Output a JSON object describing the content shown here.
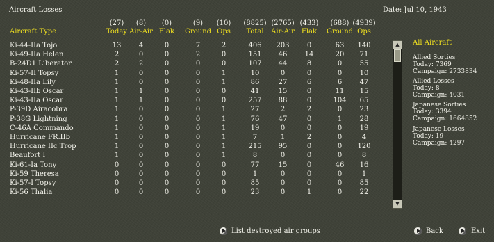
{
  "header": {
    "title": "Aircraft Losses",
    "date": "Date: Jul 10, 1943"
  },
  "columns": [
    {
      "count": "",
      "label": "Aircraft Type"
    },
    {
      "count": "(27)",
      "label": "Today"
    },
    {
      "count": "(8)",
      "label": "Air-Air"
    },
    {
      "count": "(0)",
      "label": "Flak"
    },
    {
      "count": "(9)",
      "label": "Ground"
    },
    {
      "count": "(10)",
      "label": "Ops"
    },
    {
      "count": "(8825)",
      "label": "Total"
    },
    {
      "count": "(2765)",
      "label": "Air-Air"
    },
    {
      "count": "(433)",
      "label": "Flak"
    },
    {
      "count": "(688)",
      "label": "Ground"
    },
    {
      "count": "(4939)",
      "label": "Ops"
    }
  ],
  "rows": [
    {
      "name": "Ki-44-IIa Tojo",
      "v": [
        "13",
        "4",
        "0",
        "7",
        "2",
        "406",
        "203",
        "0",
        "63",
        "140"
      ]
    },
    {
      "name": "Ki-49-IIa Helen",
      "v": [
        "2",
        "0",
        "0",
        "2",
        "0",
        "151",
        "46",
        "14",
        "20",
        "71"
      ]
    },
    {
      "name": "B-24D1 Liberator",
      "v": [
        "2",
        "2",
        "0",
        "0",
        "0",
        "107",
        "44",
        "8",
        "0",
        "55"
      ]
    },
    {
      "name": "Ki-57-II Topsy",
      "v": [
        "1",
        "0",
        "0",
        "0",
        "1",
        "10",
        "0",
        "0",
        "0",
        "10"
      ]
    },
    {
      "name": "Ki-48-IIa Lily",
      "v": [
        "1",
        "0",
        "0",
        "0",
        "1",
        "86",
        "27",
        "6",
        "6",
        "47"
      ]
    },
    {
      "name": "Ki-43-IIb Oscar",
      "v": [
        "1",
        "1",
        "0",
        "0",
        "0",
        "41",
        "15",
        "0",
        "11",
        "15"
      ]
    },
    {
      "name": "Ki-43-IIa Oscar",
      "v": [
        "1",
        "1",
        "0",
        "0",
        "0",
        "257",
        "88",
        "0",
        "104",
        "65"
      ]
    },
    {
      "name": "P-39D Airacobra",
      "v": [
        "1",
        "0",
        "0",
        "0",
        "1",
        "27",
        "2",
        "2",
        "0",
        "23"
      ]
    },
    {
      "name": "P-38G Lightning",
      "v": [
        "1",
        "0",
        "0",
        "0",
        "1",
        "76",
        "47",
        "0",
        "1",
        "28"
      ]
    },
    {
      "name": "C-46A Commando",
      "v": [
        "1",
        "0",
        "0",
        "0",
        "1",
        "19",
        "0",
        "0",
        "0",
        "19"
      ]
    },
    {
      "name": "Hurricane FR.IIb",
      "v": [
        "1",
        "0",
        "0",
        "0",
        "1",
        "7",
        "1",
        "2",
        "0",
        "4"
      ]
    },
    {
      "name": "Hurricane IIc Trop",
      "v": [
        "1",
        "0",
        "0",
        "0",
        "1",
        "215",
        "95",
        "0",
        "0",
        "120"
      ]
    },
    {
      "name": "Beaufort I",
      "v": [
        "1",
        "0",
        "0",
        "0",
        "1",
        "8",
        "0",
        "0",
        "0",
        "8"
      ]
    },
    {
      "name": "Ki-61-Ia Tony",
      "v": [
        "0",
        "0",
        "0",
        "0",
        "0",
        "77",
        "15",
        "0",
        "46",
        "16"
      ]
    },
    {
      "name": "Ki-59 Theresa",
      "v": [
        "0",
        "0",
        "0",
        "0",
        "0",
        "1",
        "0",
        "0",
        "0",
        "1"
      ]
    },
    {
      "name": "Ki-57-I Topsy",
      "v": [
        "0",
        "0",
        "0",
        "0",
        "0",
        "85",
        "0",
        "0",
        "0",
        "85"
      ]
    },
    {
      "name": "Ki-56 Thalia",
      "v": [
        "0",
        "0",
        "0",
        "0",
        "0",
        "23",
        "0",
        "1",
        "0",
        "22"
      ]
    }
  ],
  "sidebar": {
    "title": "All Aircraft",
    "allied_sorties": {
      "title": "Allied Sorties",
      "today": "Today:   7369",
      "campaign": "Campaign: 2733834"
    },
    "allied_losses": {
      "title": "Allied Losses",
      "today": "Today:   8",
      "campaign": "Campaign: 4031"
    },
    "japanese_sorties": {
      "title": "Japanese Sorties",
      "today": "Today:   3394",
      "campaign": "Campaign: 1664852"
    },
    "japanese_losses": {
      "title": "Japanese Losses",
      "today": "Today:   19",
      "campaign": "Campaign: 4297"
    }
  },
  "footer": {
    "list_label": "List destroyed air groups",
    "back_label": "Back",
    "exit_label": "Exit"
  },
  "icons": {
    "scroll_up": "up-arrow-icon",
    "scroll_down": "down-arrow-icon",
    "button": "play-arrow-icon"
  },
  "colors": {
    "header": "#f0e020",
    "text": "#f2f2ea",
    "background": "#3f4238"
  }
}
